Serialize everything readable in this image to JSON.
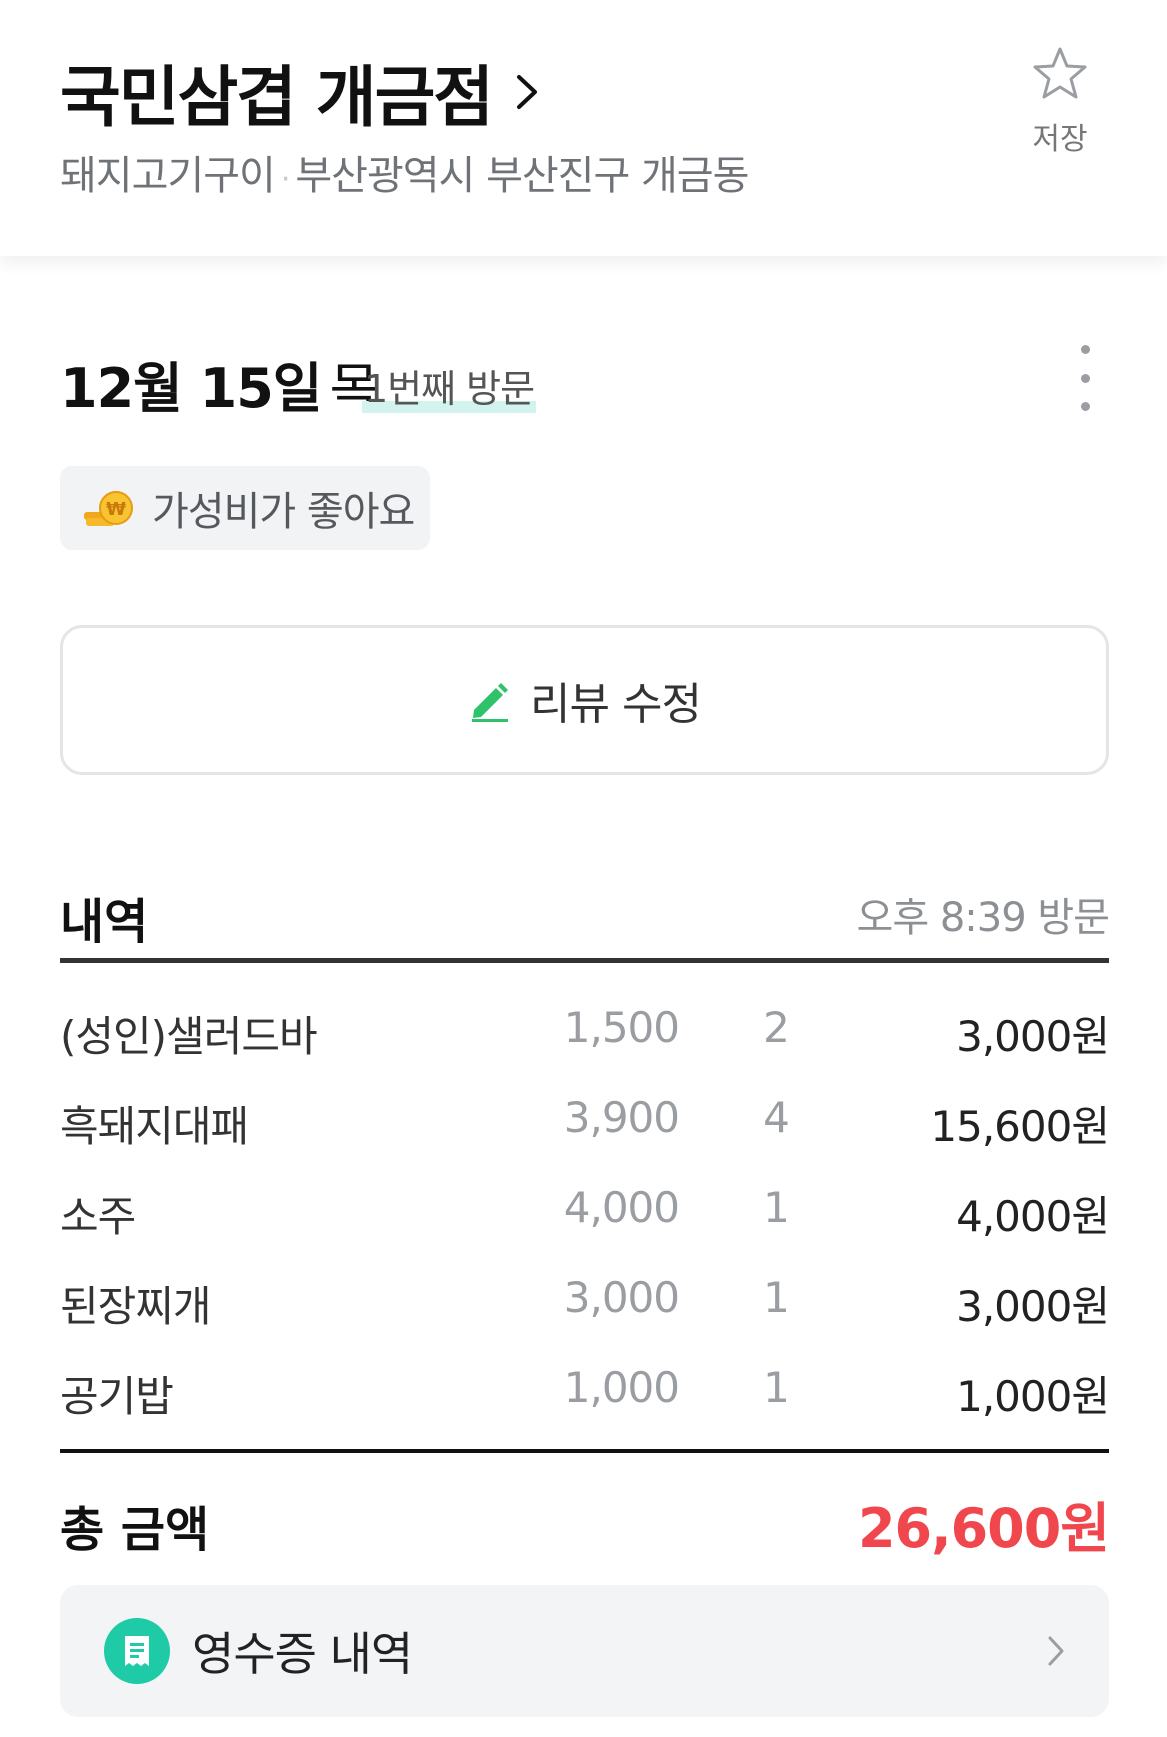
{
  "store": {
    "name": "국민삼겹 개금점",
    "category": "돼지고기구이",
    "separator": "·",
    "address": "부산광역시 부산진구 개금동",
    "save_label": "저장"
  },
  "visit": {
    "date": "12월 15일",
    "weekday": "목",
    "count_label": "1번째 방문"
  },
  "review": {
    "tag": "가성비가 좋아요",
    "edit_label": "리뷰 수정"
  },
  "detail": {
    "title": "내역",
    "time": "오후 8:39 방문",
    "items": [
      {
        "name": "(성인)샐러드바",
        "price": "1,500",
        "qty": "2",
        "amount": "3,000원"
      },
      {
        "name": "흑돼지대패",
        "price": "3,900",
        "qty": "4",
        "amount": "15,600원"
      },
      {
        "name": "소주",
        "price": "4,000",
        "qty": "1",
        "amount": "4,000원"
      },
      {
        "name": "된장찌개",
        "price": "3,000",
        "qty": "1",
        "amount": "3,000원"
      },
      {
        "name": "공기밥",
        "price": "1,000",
        "qty": "1",
        "amount": "1,000원"
      }
    ],
    "total_label": "총 금액",
    "total_value": "26,600원"
  },
  "receipt": {
    "label": "영수증 내역"
  },
  "icons": {
    "chevron": "chevron-right-icon",
    "star": "star-outline-icon",
    "more": "more-vertical-icon",
    "coin": "coins-won-icon",
    "pencil": "pencil-icon",
    "receipt": "receipt-icon"
  },
  "colors": {
    "accent_green": "#1fcaa6",
    "pencil_green": "#2ec36b",
    "total_red": "#f0474e"
  }
}
